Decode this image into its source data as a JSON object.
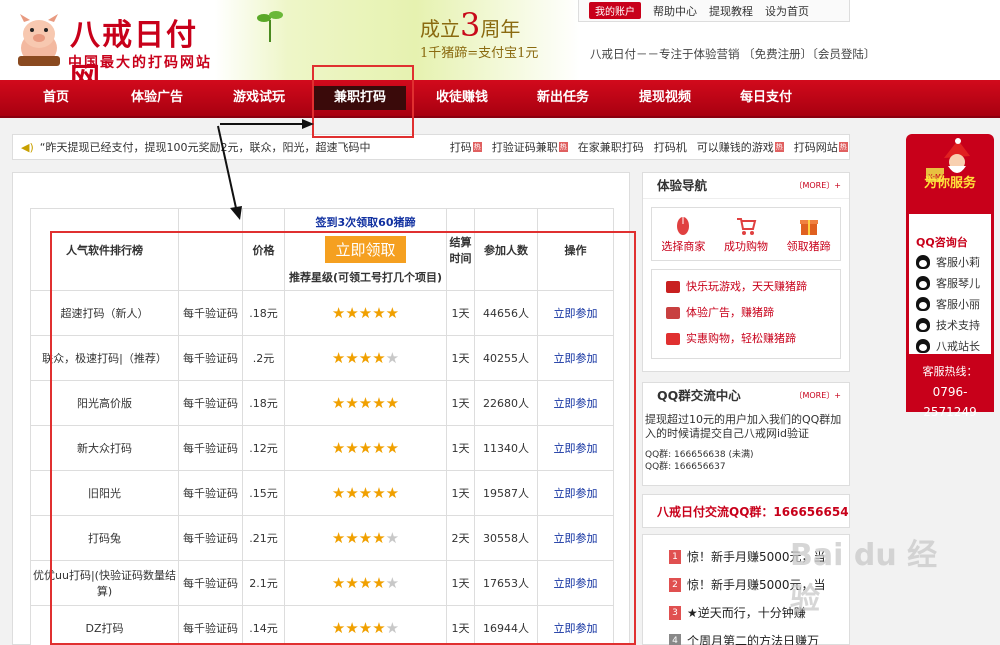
{
  "logo": {
    "title": "八戒日付网",
    "subtitle": "中国最大的打码网站"
  },
  "banner": {
    "anniv_prefix": "成立",
    "anniv_num": "3",
    "anniv_suffix": "周年",
    "rate": "1千猪蹄=支付宝1元"
  },
  "topbar": {
    "my_account": "我的账户",
    "links": [
      "帮助中心",
      "提现教程",
      "设为首页"
    ]
  },
  "slogan": "八戒日付－－专注于体验营销 〔免费注册〕〔会员登陆〕",
  "nav": [
    "首页",
    "体验广告",
    "游戏试玩",
    "兼职打码",
    "收徒赚钱",
    "新出任务",
    "提现视频",
    "每日支付"
  ],
  "ticker": {
    "text": "“昨天提现已经支付，提现100元奖励2元，联众，阳光，超速飞码中",
    "tags": [
      "打码",
      "打验证码兼职",
      "在家兼职打码",
      "打码机",
      "可以赚钱的游戏",
      "打码网站"
    ]
  },
  "table": {
    "headers": {
      "name": "人气软件排行榜",
      "price": "价格",
      "signup": "签到3次领取60猪蹄",
      "claim": "立即领取",
      "stars": "推荐星级(可领工号打几个项目)",
      "settle": "结算时间",
      "count": "参加人数",
      "op": "操作"
    },
    "rows": [
      {
        "name": "超速打码（新人）",
        "unit": "每千验证码",
        "price": ".18元",
        "stars": 5,
        "settle": "1天",
        "count": "44656人",
        "op": "立即参加"
      },
      {
        "name": "联众，极速打码|（推荐）",
        "unit": "每千验证码",
        "price": ".2元",
        "stars": 4,
        "settle": "1天",
        "count": "40255人",
        "op": "立即参加"
      },
      {
        "name": "阳光高价版",
        "unit": "每千验证码",
        "price": ".18元",
        "stars": 5,
        "settle": "1天",
        "count": "22680人",
        "op": "立即参加"
      },
      {
        "name": "新大众打码",
        "unit": "每千验证码",
        "price": ".12元",
        "stars": 5,
        "settle": "1天",
        "count": "11340人",
        "op": "立即参加"
      },
      {
        "name": "旧阳光",
        "unit": "每千验证码",
        "price": ".15元",
        "stars": 5,
        "settle": "1天",
        "count": "19587人",
        "op": "立即参加"
      },
      {
        "name": "打码兔",
        "unit": "每千验证码",
        "price": ".21元",
        "stars": 4,
        "settle": "2天",
        "count": "30558人",
        "op": "立即参加"
      },
      {
        "name": "优优uu打码|(快验证码数量结算)",
        "unit": "每千验证码",
        "price": "2.1元",
        "stars": 4,
        "settle": "1天",
        "count": "17653人",
        "op": "立即参加"
      },
      {
        "name": "DZ打码",
        "unit": "每千验证码",
        "price": ".14元",
        "stars": 4,
        "settle": "1天",
        "count": "16944人",
        "op": "立即参加"
      }
    ]
  },
  "sidebar": {
    "guide_title": "体验导航",
    "more": "MORE",
    "steps": [
      "选择商家",
      "成功购物",
      "领取猪蹄"
    ],
    "promos": [
      "快乐玩游戏，天天赚猪蹄",
      "体验广告，赚猪蹄",
      "实惠购物，轻松赚猪蹄"
    ],
    "qq_title": "QQ群交流中心",
    "qq_text": "提现超过10元的用户加入我们的QQ群加入的时候请提交自己八戒网id验证",
    "qq_nums": [
      "QQ群: 166656638 (未满)",
      "QQ群: 166656637"
    ],
    "jiaoliu": "八戒日付交流QQ群：166656654",
    "news": [
      "惊！新手月赚5000元，当",
      "惊！新手月赚5000元，当",
      "★逆天而行，十分钟赚",
      "个周月第二的方法日赚万"
    ]
  },
  "service": {
    "xmas": "X-MAS",
    "title": "为你服务",
    "console": "QQ咨询台",
    "staff": [
      "客服小莉",
      "客服琴儿",
      "客服小丽",
      "技术支持",
      "八戒站长"
    ],
    "hotline_label": "客服热线：",
    "hotline": "0796-2571249"
  },
  "watermark": "Bai du 经验",
  "colors": {
    "brand_red": "#c8001a",
    "nav_active": "#3a0a0a",
    "link_blue": "#1030a0",
    "star_gold": "#f0a000"
  }
}
